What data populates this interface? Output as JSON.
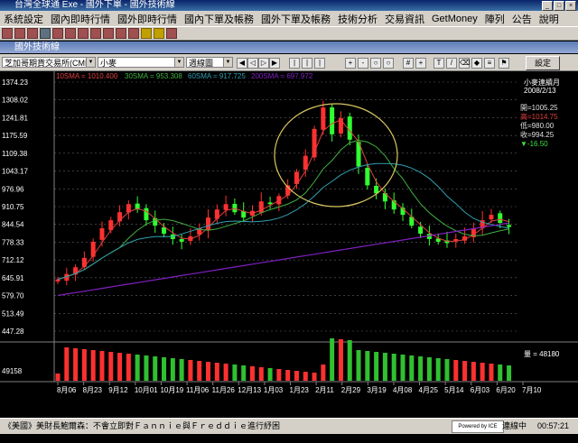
{
  "window": {
    "title": "台灣全球通 Exe - 國外下單 - 國外技術線",
    "min": "_",
    "max": "□",
    "close": "×"
  },
  "menu": [
    "系統設定",
    "國內即時行情",
    "國外即時行情",
    "國內下單及帳務",
    "國外下單及帳務",
    "技術分析",
    "交易資訊",
    "GetMoney",
    "陣列",
    "公告",
    "說明"
  ],
  "child": {
    "title": "國外技術線"
  },
  "toolbar": {
    "exchange": "芝加哥期貨交易所(CME)",
    "product": "小麥",
    "period": "週線圖",
    "settings_label": "設定"
  },
  "indicators": {
    "sma10": "10SMA = 1010.400",
    "sma30": "30SMA = 953.308",
    "sma60": "60SMA = 917.725",
    "sma200": "200SMA = 697.972",
    "colors": {
      "sma10": "#e04040",
      "sma30": "#40b040",
      "sma60": "#30a0b0",
      "sma200": "#8020c0"
    }
  },
  "info": {
    "name": "小麥連續月",
    "date": "2008/2/13",
    "open": "開=1005.25",
    "high": "高=1014.75",
    "low": "低=980.00",
    "close": "收=994.25",
    "chg": "▼-16.50"
  },
  "volume": {
    "label": "量 = 48180",
    "max_tick": "49158"
  },
  "chart_data": {
    "type": "candlestick",
    "y_ticks": [
      "1374.23",
      "1308.02",
      "1241.81",
      "1175.59",
      "1109.38",
      "1043.17",
      "976.96",
      "910.75",
      "844.54",
      "778.33",
      "712.12",
      "645.91",
      "579.70",
      "513.49",
      "447.28"
    ],
    "ylim": [
      447.28,
      1374.23
    ],
    "x_ticks": [
      "8月06",
      "8月23",
      "9月12",
      "10月01",
      "10月19",
      "11月06",
      "11月26",
      "12月13",
      "1月03",
      "1月23",
      "2月11",
      "2月29",
      "3月19",
      "4月08",
      "4月25",
      "5月14",
      "6月03",
      "6月20",
      "7月10"
    ],
    "close_series": [
      640,
      660,
      685,
      720,
      780,
      830,
      860,
      890,
      920,
      900,
      860,
      840,
      810,
      790,
      780,
      800,
      830,
      870,
      900,
      920,
      890,
      870,
      895,
      930,
      920,
      950,
      990,
      1040,
      1100,
      1200,
      1280,
      1180,
      1240,
      1160,
      1060,
      990,
      960,
      930,
      900,
      880,
      840,
      810,
      790,
      780,
      775,
      790,
      800,
      830,
      860,
      880,
      850,
      835
    ]
  },
  "status": {
    "news": "《美國》美財長鮑爾森：不會立即對Ｆａｎｎｉｅ與Ｆｒｅｄｄｉｅ進行紓困",
    "powered": "Powered by ICE Tech",
    "conn": "連線中",
    "time": "00:57:21"
  }
}
